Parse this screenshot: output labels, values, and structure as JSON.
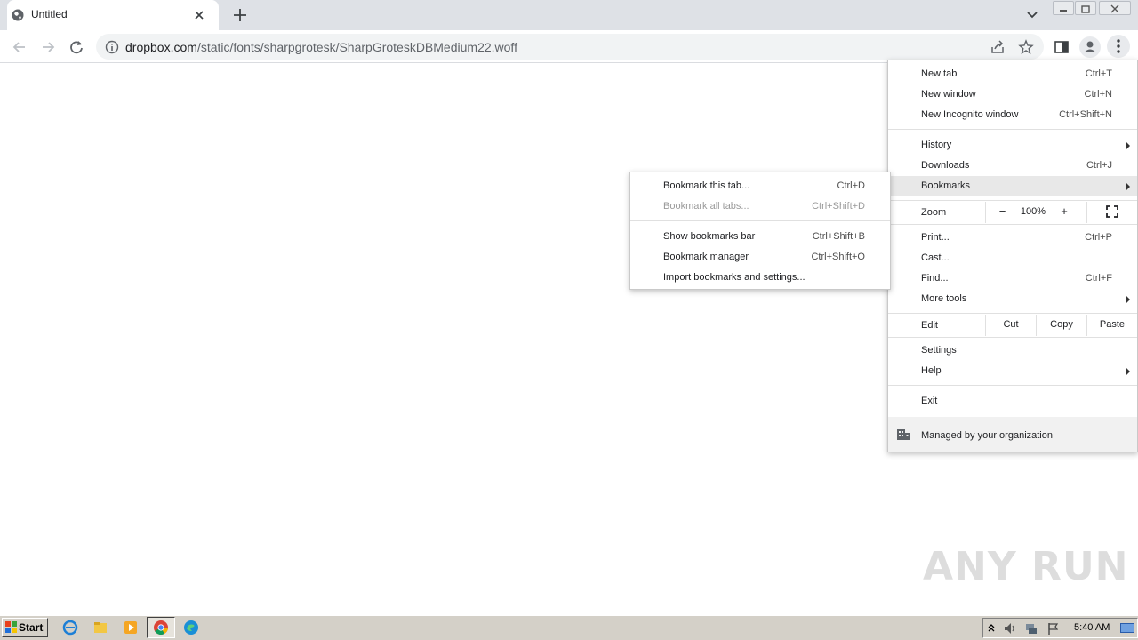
{
  "browser": {
    "tab_title": "Untitled",
    "url_domain": "dropbox.com",
    "url_path": "/static/fonts/sharpgrotesk/SharpGroteskDBMedium22.woff"
  },
  "main_menu": {
    "new_tab": {
      "label": "New tab",
      "shortcut": "Ctrl+T"
    },
    "new_window": {
      "label": "New window",
      "shortcut": "Ctrl+N"
    },
    "new_incognito": {
      "label": "New Incognito window",
      "shortcut": "Ctrl+Shift+N"
    },
    "history": {
      "label": "History"
    },
    "downloads": {
      "label": "Downloads",
      "shortcut": "Ctrl+J"
    },
    "bookmarks": {
      "label": "Bookmarks"
    },
    "zoom": {
      "label": "Zoom",
      "minus": "−",
      "value": "100%",
      "plus": "+"
    },
    "print": {
      "label": "Print...",
      "shortcut": "Ctrl+P"
    },
    "cast": {
      "label": "Cast..."
    },
    "find": {
      "label": "Find...",
      "shortcut": "Ctrl+F"
    },
    "more_tools": {
      "label": "More tools"
    },
    "edit": {
      "label": "Edit",
      "cut": "Cut",
      "copy": "Copy",
      "paste": "Paste"
    },
    "settings": {
      "label": "Settings"
    },
    "help": {
      "label": "Help"
    },
    "exit": {
      "label": "Exit"
    },
    "managed": {
      "label": "Managed by your organization"
    }
  },
  "bookmarks_menu": {
    "bookmark_tab": {
      "label": "Bookmark this tab...",
      "shortcut": "Ctrl+D"
    },
    "bookmark_all": {
      "label": "Bookmark all tabs...",
      "shortcut": "Ctrl+Shift+D"
    },
    "show_bar": {
      "label": "Show bookmarks bar",
      "shortcut": "Ctrl+Shift+B"
    },
    "manager": {
      "label": "Bookmark manager",
      "shortcut": "Ctrl+Shift+O"
    },
    "import": {
      "label": "Import bookmarks and settings..."
    }
  },
  "watermark": "ANY RUN",
  "taskbar": {
    "start_label": "Start",
    "clock": "5:40 AM"
  }
}
